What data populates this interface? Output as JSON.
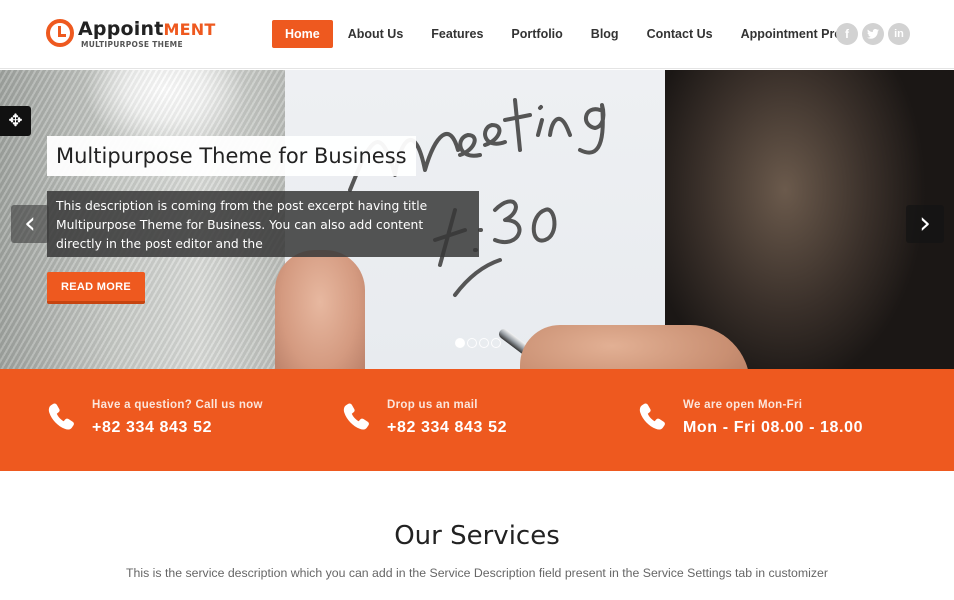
{
  "header": {
    "logo": {
      "icon": "clock-icon",
      "title_dark": "Appoint",
      "title_accent": "ment",
      "subtitle": "MULTIPURPOSE THEME"
    },
    "nav": [
      {
        "label": "Home",
        "active": true
      },
      {
        "label": "About Us",
        "active": false
      },
      {
        "label": "Features",
        "active": false
      },
      {
        "label": "Portfolio",
        "active": false
      },
      {
        "label": "Blog",
        "active": false
      },
      {
        "label": "Contact Us",
        "active": false
      },
      {
        "label": "Appointment Pro",
        "active": false
      }
    ],
    "social": [
      {
        "icon": "facebook-icon",
        "glyph": "f"
      },
      {
        "icon": "twitter-icon",
        "glyph": "t"
      },
      {
        "icon": "linkedin-icon",
        "glyph": "in"
      }
    ]
  },
  "slider": {
    "image_text": "Meeting 14:30",
    "move_glyph": "✥",
    "title": "Multipurpose Theme for Business",
    "description": "This description is coming from the post excerpt having title Multipurpose Theme for Business. You can also add content directly in the post editor and the",
    "button_label": "READ MORE",
    "prev_glyph": "‹",
    "next_glyph": "›",
    "slides_count": 4,
    "active_slide": 1
  },
  "contact": [
    {
      "icon": "phone-icon",
      "label": "Have a question? Call us now",
      "value": "+82 334 843 52"
    },
    {
      "icon": "phone-icon",
      "label": "Drop us an mail",
      "value": "+82 334 843 52"
    },
    {
      "icon": "phone-icon",
      "label": "We are open Mon-Fri",
      "value": "Mon - Fri 08.00 - 18.00"
    }
  ],
  "services": {
    "title": "Our Services",
    "description": "This is the service description which you can add in the Service Description field present in the Service Settings tab in customizer"
  },
  "colors": {
    "accent": "#ee591f",
    "social_bg": "#d2d2d2",
    "text_dark": "#222222"
  }
}
